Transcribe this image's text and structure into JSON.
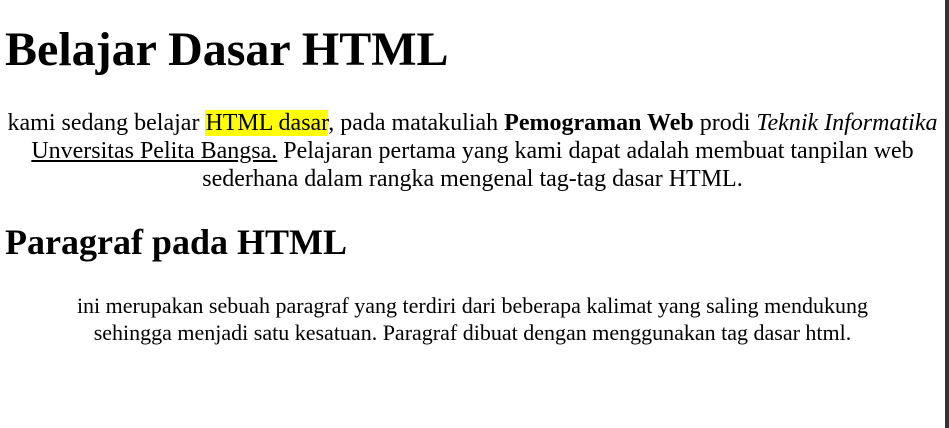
{
  "heading1": "Belajar Dasar HTML",
  "paragraph1": {
    "line1": {
      "pre": "kami sedang belajar ",
      "highlight": "HTML dasar",
      "mid": ", pada matakuliah ",
      "bold": "Pemograman Web",
      "mid2": " prodi ",
      "italic": "Teknik Informatika"
    },
    "line2": {
      "underline": "Unversitas Pelita Bangsa.",
      "rest": " Pelajaran pertama yang kami dapat adalah membuat tanpilan web"
    },
    "line3": "sederhana dalam rangka mengenal tag-tag dasar HTML."
  },
  "heading2": "Paragraf pada HTML",
  "paragraph2": {
    "line1": "ini merupakan sebuah paragraf yang terdiri dari beberapa kalimat yang saling mendukung",
    "line2": "sehingga menjadi satu kesatuan. Paragraf dibuat dengan menggunakan tag dasar html."
  },
  "colors": {
    "highlight": "#ffff00",
    "text": "#000000",
    "background": "#ffffff"
  }
}
